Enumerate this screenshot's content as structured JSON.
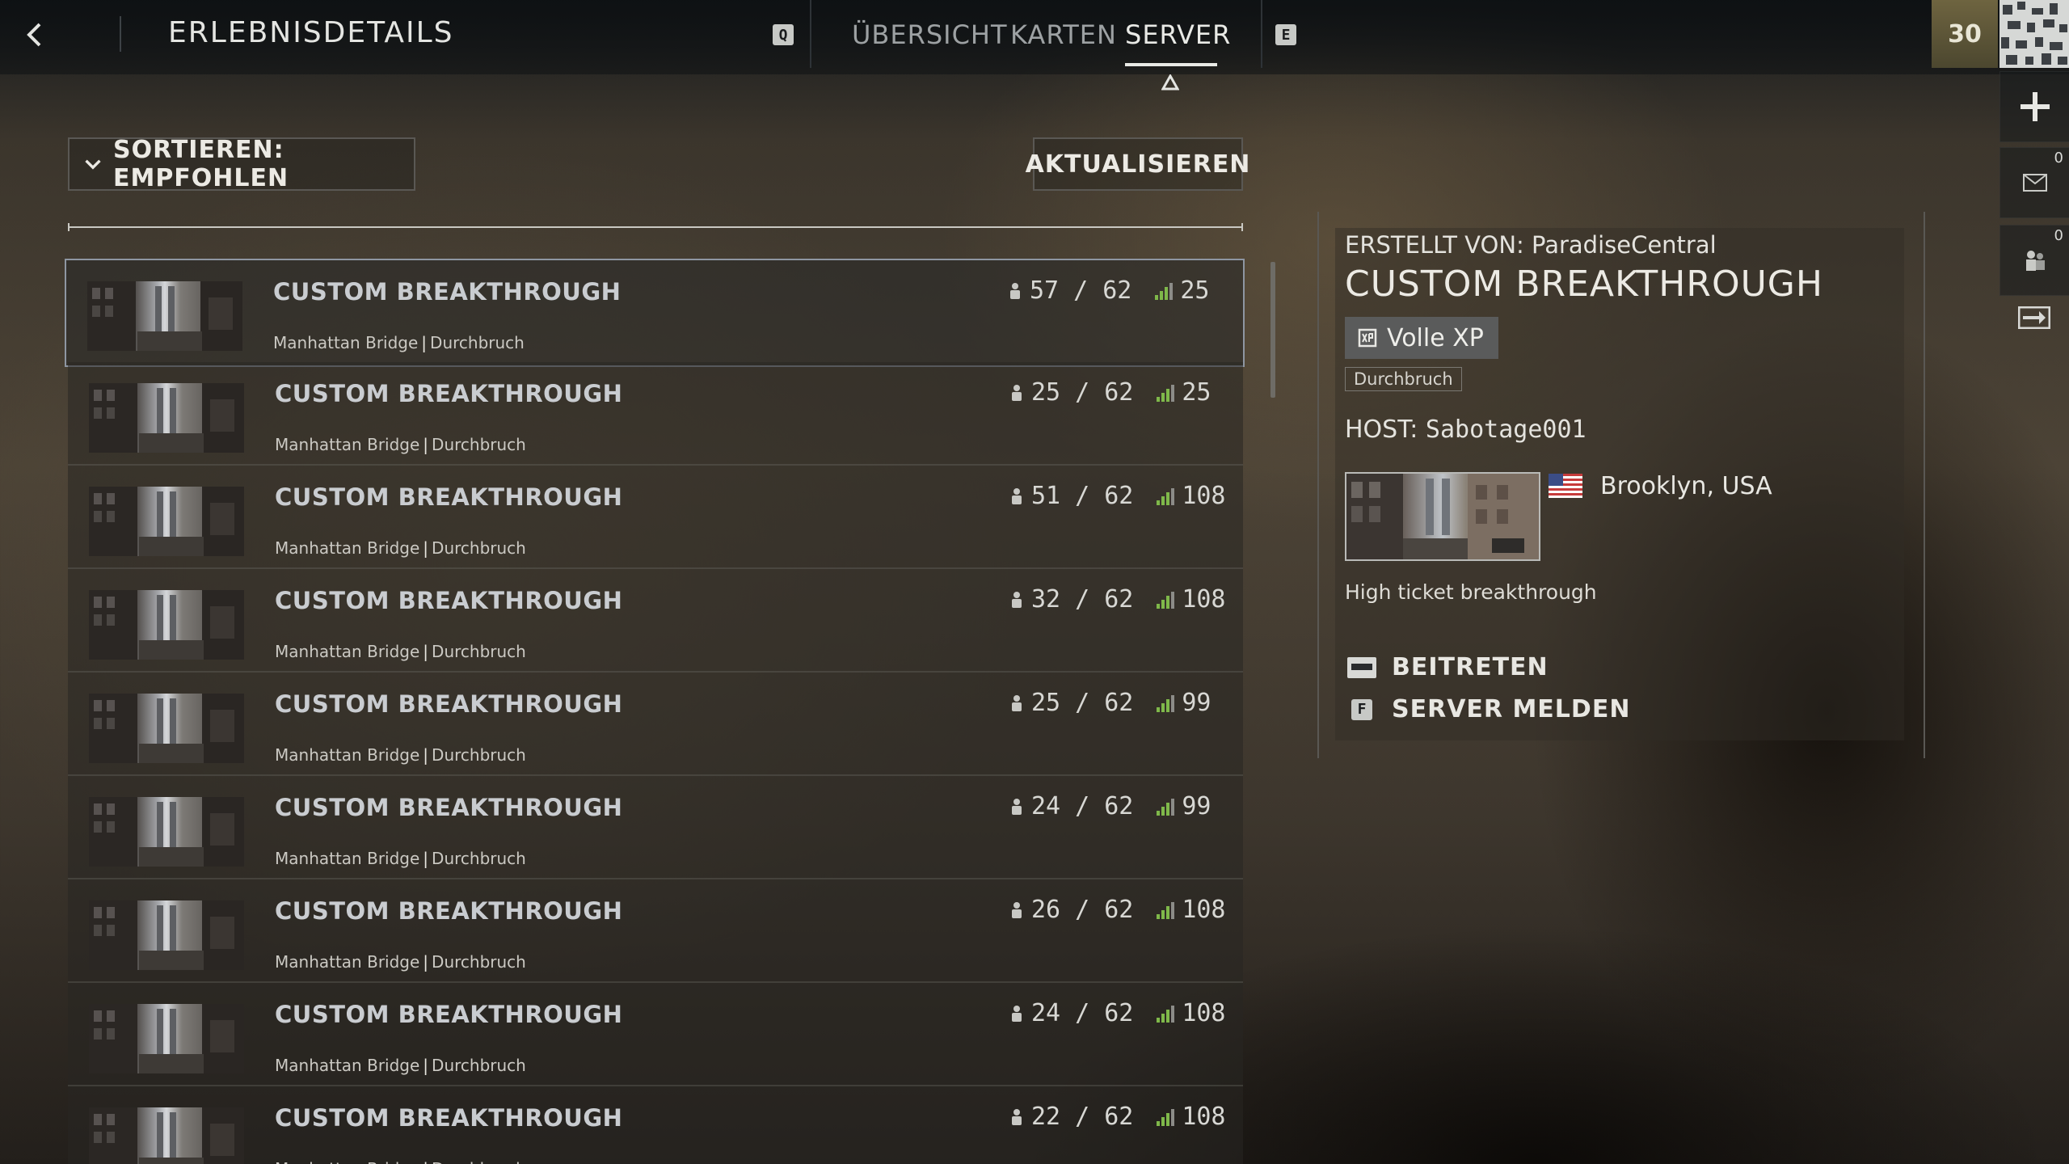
{
  "header": {
    "title": "ERLEBNISDETAILS",
    "key_prev": "Q",
    "key_next": "E",
    "tabs": [
      {
        "label": "ÜBERSICHT"
      },
      {
        "label": "KARTEN"
      },
      {
        "label": "SERVER"
      }
    ],
    "active_tab": "SERVER"
  },
  "sidebar": {
    "level": "30",
    "mail_count": "0",
    "squad_count": "0"
  },
  "toolbar": {
    "sort_label": "SORTIEREN: EMPFOHLEN",
    "refresh_label": "AKTUALISIEREN"
  },
  "servers": [
    {
      "name": "CUSTOM BREAKTHROUGH",
      "map": "Manhattan Bridge",
      "mode": "Durchbruch",
      "players": "57",
      "max": "62",
      "ping": "25"
    },
    {
      "name": "CUSTOM BREAKTHROUGH",
      "map": "Manhattan Bridge",
      "mode": "Durchbruch",
      "players": "25",
      "max": "62",
      "ping": "25"
    },
    {
      "name": "CUSTOM BREAKTHROUGH",
      "map": "Manhattan Bridge",
      "mode": "Durchbruch",
      "players": "51",
      "max": "62",
      "ping": "108"
    },
    {
      "name": "CUSTOM BREAKTHROUGH",
      "map": "Manhattan Bridge",
      "mode": "Durchbruch",
      "players": "32",
      "max": "62",
      "ping": "108"
    },
    {
      "name": "CUSTOM BREAKTHROUGH",
      "map": "Manhattan Bridge",
      "mode": "Durchbruch",
      "players": "25",
      "max": "62",
      "ping": "99"
    },
    {
      "name": "CUSTOM BREAKTHROUGH",
      "map": "Manhattan Bridge",
      "mode": "Durchbruch",
      "players": "24",
      "max": "62",
      "ping": "99"
    },
    {
      "name": "CUSTOM BREAKTHROUGH",
      "map": "Manhattan Bridge",
      "mode": "Durchbruch",
      "players": "26",
      "max": "62",
      "ping": "108"
    },
    {
      "name": "CUSTOM BREAKTHROUGH",
      "map": "Manhattan Bridge",
      "mode": "Durchbruch",
      "players": "24",
      "max": "62",
      "ping": "108"
    },
    {
      "name": "CUSTOM BREAKTHROUGH",
      "map": "Manhattan Bridge",
      "mode": "Durchbruch",
      "players": "22",
      "max": "62",
      "ping": "108"
    }
  ],
  "detail": {
    "creator_label": "ERSTELLT VON:",
    "creator": "ParadiseCentral",
    "title": "CUSTOM BREAKTHROUGH",
    "xp_label": "Volle XP",
    "mode_tag": "Durchbruch",
    "host_label": "HOST:",
    "host": "Sabotage001",
    "location": "Brooklyn, USA",
    "description": "High ticket breakthrough",
    "join_label": "BEITRETEN",
    "report_key": "F",
    "report_label": "SERVER MELDEN"
  },
  "colors": {
    "ping_bars": "#7fb84a",
    "selected_border": "#8e96a2"
  }
}
